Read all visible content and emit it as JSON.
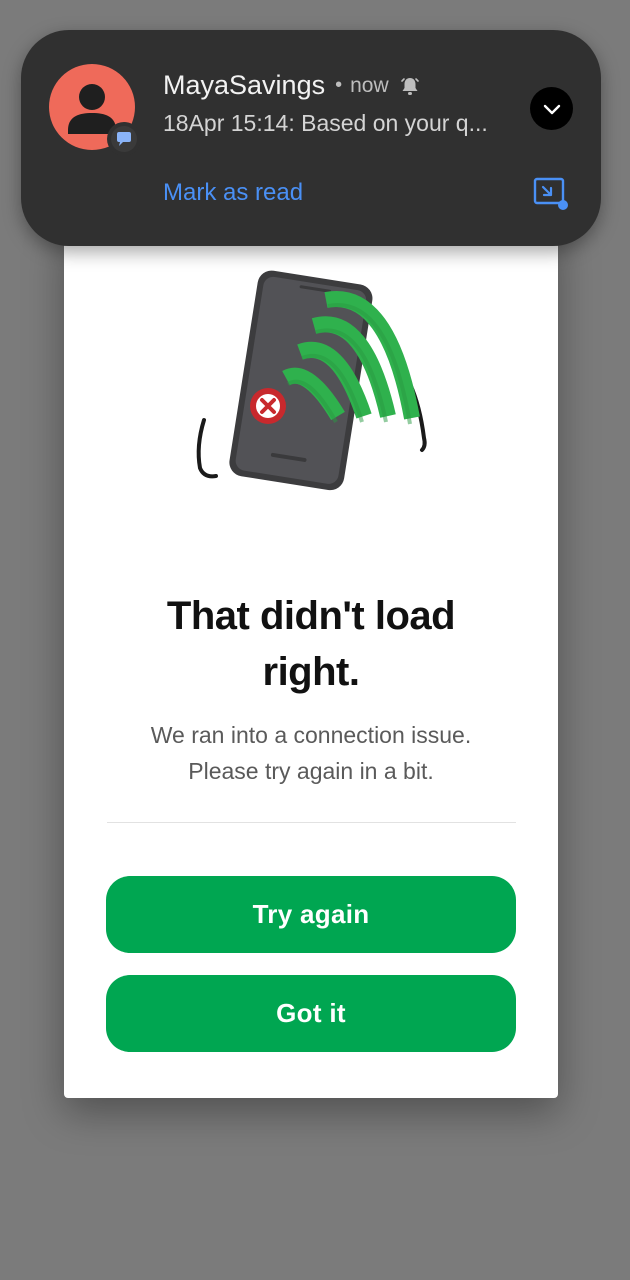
{
  "notification": {
    "app_name": "MayaSavings",
    "separator": "•",
    "time": "now",
    "message": "18Apr 15:14: Based on your q...",
    "action_label": "Mark as read",
    "avatar_color": "#ef6a5a",
    "icons": {
      "avatar": "person-avatar-icon",
      "badge": "chat-bubble-icon",
      "bell": "bell-icon",
      "expand": "chevron-down-icon",
      "bubble": "open-in-bubble-icon"
    }
  },
  "dialog": {
    "illustration": "phone-signal-error-icon",
    "title_line1": "That didn't load",
    "title_line2": "right.",
    "message_line1": "We ran into a connection issue.",
    "message_line2": "Please try again in a bit.",
    "primary_button": "Try again",
    "secondary_button": "Got it",
    "accent_color": "#00a651"
  }
}
